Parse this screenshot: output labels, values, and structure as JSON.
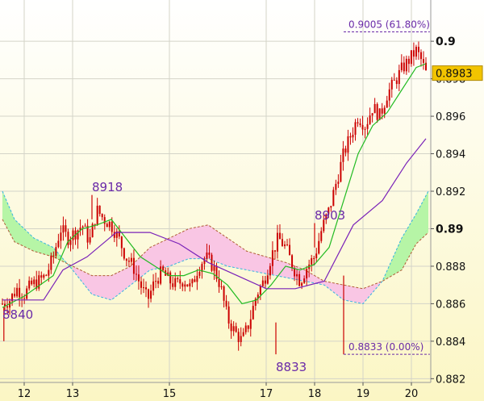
{
  "chart_data": {
    "type": "line",
    "ylim": [
      0.8818,
      0.9022
    ],
    "xlim": [
      11.5,
      20.4
    ],
    "grid": true,
    "colors": {
      "candle": "#cc0000",
      "tenkan": "#22bb22",
      "kijun": "#7a22b8",
      "cloud_bull_fill": "#b6f5a6",
      "cloud_bear_fill": "#f9c6e4",
      "cloud_edge_bull": "#35b5e0",
      "cloud_edge_bear": "#b05c36",
      "fib": "#6a2aa8",
      "price_tag": "#f2c400"
    },
    "y_ticks": [
      {
        "value": 0.882,
        "label": "0.882",
        "major": false
      },
      {
        "value": 0.884,
        "label": "0.884",
        "major": false
      },
      {
        "value": 0.886,
        "label": "0.886",
        "major": false
      },
      {
        "value": 0.888,
        "label": "0.888",
        "major": false
      },
      {
        "value": 0.89,
        "label": "0.89",
        "major": true
      },
      {
        "value": 0.892,
        "label": "0.892",
        "major": false
      },
      {
        "value": 0.894,
        "label": "0.894",
        "major": false
      },
      {
        "value": 0.896,
        "label": "0.896",
        "major": false
      },
      {
        "value": 0.898,
        "label": "0.898",
        "major": false
      },
      {
        "value": 0.9,
        "label": "0.9",
        "major": true
      }
    ],
    "x_ticks": [
      {
        "value": 12,
        "label": "12"
      },
      {
        "value": 13,
        "label": "13"
      },
      {
        "value": 15,
        "label": "15"
      },
      {
        "value": 17,
        "label": "17"
      },
      {
        "value": 18,
        "label": "18"
      },
      {
        "value": 19,
        "label": "19"
      },
      {
        "value": 20,
        "label": "20"
      }
    ],
    "price_path": [
      [
        11.55,
        0.886
      ],
      [
        11.7,
        0.8862
      ],
      [
        11.85,
        0.8868
      ],
      [
        12.0,
        0.8865
      ],
      [
        12.15,
        0.887
      ],
      [
        12.3,
        0.8872
      ],
      [
        12.45,
        0.8875
      ],
      [
        12.6,
        0.8885
      ],
      [
        12.75,
        0.89
      ],
      [
        12.9,
        0.8895
      ],
      [
        13.05,
        0.8898
      ],
      [
        13.2,
        0.8902
      ],
      [
        13.35,
        0.8893
      ],
      [
        13.5,
        0.891
      ],
      [
        13.65,
        0.8905
      ],
      [
        13.8,
        0.8902
      ],
      [
        13.95,
        0.8895
      ],
      [
        14.1,
        0.8885
      ],
      [
        14.25,
        0.888
      ],
      [
        14.4,
        0.887
      ],
      [
        14.55,
        0.8862
      ],
      [
        14.7,
        0.8872
      ],
      [
        14.85,
        0.8877
      ],
      [
        15.0,
        0.8872
      ],
      [
        15.15,
        0.887
      ],
      [
        15.3,
        0.8873
      ],
      [
        15.45,
        0.8868
      ],
      [
        15.6,
        0.888
      ],
      [
        15.75,
        0.8885
      ],
      [
        15.9,
        0.888
      ],
      [
        16.05,
        0.887
      ],
      [
        16.2,
        0.8852
      ],
      [
        16.35,
        0.8845
      ],
      [
        16.5,
        0.884
      ],
      [
        16.65,
        0.885
      ],
      [
        16.8,
        0.8865
      ],
      [
        16.95,
        0.8872
      ],
      [
        17.1,
        0.8885
      ],
      [
        17.25,
        0.8895
      ],
      [
        17.4,
        0.889
      ],
      [
        17.55,
        0.888
      ],
      [
        17.7,
        0.8872
      ],
      [
        17.85,
        0.888
      ],
      [
        18.0,
        0.8885
      ],
      [
        18.15,
        0.89
      ],
      [
        18.3,
        0.891
      ],
      [
        18.45,
        0.8925
      ],
      [
        18.6,
        0.894
      ],
      [
        18.75,
        0.895
      ],
      [
        18.9,
        0.896
      ],
      [
        19.05,
        0.8955
      ],
      [
        19.2,
        0.8965
      ],
      [
        19.35,
        0.896
      ],
      [
        19.5,
        0.8972
      ],
      [
        19.65,
        0.8978
      ],
      [
        19.8,
        0.8985
      ],
      [
        19.95,
        0.899
      ],
      [
        20.1,
        0.8995
      ],
      [
        20.2,
        0.899
      ],
      [
        20.3,
        0.8983
      ]
    ],
    "tenkan_path": [
      [
        11.55,
        0.8858
      ],
      [
        12.0,
        0.8864
      ],
      [
        12.6,
        0.8875
      ],
      [
        12.9,
        0.8893
      ],
      [
        13.2,
        0.89
      ],
      [
        13.5,
        0.8902
      ],
      [
        13.8,
        0.8905
      ],
      [
        14.1,
        0.8895
      ],
      [
        14.4,
        0.8885
      ],
      [
        14.7,
        0.888
      ],
      [
        15.0,
        0.8875
      ],
      [
        15.3,
        0.8875
      ],
      [
        15.6,
        0.8878
      ],
      [
        15.9,
        0.8876
      ],
      [
        16.2,
        0.887
      ],
      [
        16.5,
        0.886
      ],
      [
        16.8,
        0.8862
      ],
      [
        17.1,
        0.887
      ],
      [
        17.4,
        0.888
      ],
      [
        17.7,
        0.8878
      ],
      [
        18.0,
        0.8881
      ],
      [
        18.3,
        0.889
      ],
      [
        18.6,
        0.8915
      ],
      [
        18.9,
        0.894
      ],
      [
        19.2,
        0.8955
      ],
      [
        19.5,
        0.8962
      ],
      [
        19.8,
        0.8974
      ],
      [
        20.1,
        0.8986
      ],
      [
        20.3,
        0.8988
      ]
    ],
    "kijun_path": [
      [
        11.55,
        0.8862
      ],
      [
        12.4,
        0.8862
      ],
      [
        12.8,
        0.8878
      ],
      [
        13.3,
        0.8885
      ],
      [
        13.9,
        0.8898
      ],
      [
        14.6,
        0.8898
      ],
      [
        15.2,
        0.8892
      ],
      [
        15.8,
        0.8882
      ],
      [
        16.4,
        0.8875
      ],
      [
        17.0,
        0.8868
      ],
      [
        17.6,
        0.8868
      ],
      [
        18.2,
        0.8872
      ],
      [
        18.8,
        0.8902
      ],
      [
        19.4,
        0.8915
      ],
      [
        19.9,
        0.8935
      ],
      [
        20.3,
        0.8948
      ]
    ],
    "cloud_a": [
      [
        11.55,
        0.892
      ],
      [
        11.8,
        0.8905
      ],
      [
        12.2,
        0.8895
      ],
      [
        12.6,
        0.889
      ],
      [
        13.0,
        0.8878
      ],
      [
        13.4,
        0.8865
      ],
      [
        13.8,
        0.8862
      ],
      [
        14.2,
        0.887
      ],
      [
        14.6,
        0.8878
      ],
      [
        15.0,
        0.888
      ],
      [
        15.4,
        0.8884
      ],
      [
        15.8,
        0.8884
      ],
      [
        16.2,
        0.888
      ],
      [
        16.6,
        0.8878
      ],
      [
        17.0,
        0.8876
      ],
      [
        17.4,
        0.8874
      ],
      [
        17.8,
        0.8872
      ],
      [
        18.2,
        0.887
      ],
      [
        18.6,
        0.8862
      ],
      [
        19.0,
        0.886
      ],
      [
        19.4,
        0.8872
      ],
      [
        19.8,
        0.8895
      ],
      [
        20.1,
        0.8908
      ],
      [
        20.35,
        0.892
      ]
    ],
    "cloud_b": [
      [
        11.55,
        0.8905
      ],
      [
        11.8,
        0.8893
      ],
      [
        12.2,
        0.8888
      ],
      [
        12.6,
        0.8885
      ],
      [
        13.0,
        0.888
      ],
      [
        13.4,
        0.8875
      ],
      [
        13.8,
        0.8875
      ],
      [
        14.2,
        0.888
      ],
      [
        14.6,
        0.889
      ],
      [
        15.0,
        0.8895
      ],
      [
        15.4,
        0.89
      ],
      [
        15.8,
        0.8902
      ],
      [
        16.2,
        0.8895
      ],
      [
        16.6,
        0.8888
      ],
      [
        17.0,
        0.8885
      ],
      [
        17.4,
        0.8882
      ],
      [
        17.8,
        0.8878
      ],
      [
        18.2,
        0.8872
      ],
      [
        18.6,
        0.887
      ],
      [
        19.0,
        0.8868
      ],
      [
        19.4,
        0.8872
      ],
      [
        19.8,
        0.8878
      ],
      [
        20.1,
        0.8892
      ],
      [
        20.35,
        0.8898
      ]
    ],
    "fib_levels": [
      {
        "value": 0.9005,
        "x_start": 18.6,
        "x_end": 20.38,
        "label": "0.9005 (61.80%)"
      },
      {
        "value": 0.8833,
        "x_start": 18.6,
        "x_end": 20.38,
        "label": "0.8833 (0.00%)"
      }
    ],
    "annotations": [
      {
        "text": "8918",
        "x": 13.4,
        "y": 0.892
      },
      {
        "text": "8903",
        "x": 18.0,
        "y": 0.8905
      },
      {
        "text": "8840",
        "x": 11.55,
        "y": 0.8852
      },
      {
        "text": "8833",
        "x": 17.2,
        "y": 0.8824
      }
    ],
    "last_price": {
      "value": 0.8983,
      "label": "0.8983"
    }
  }
}
